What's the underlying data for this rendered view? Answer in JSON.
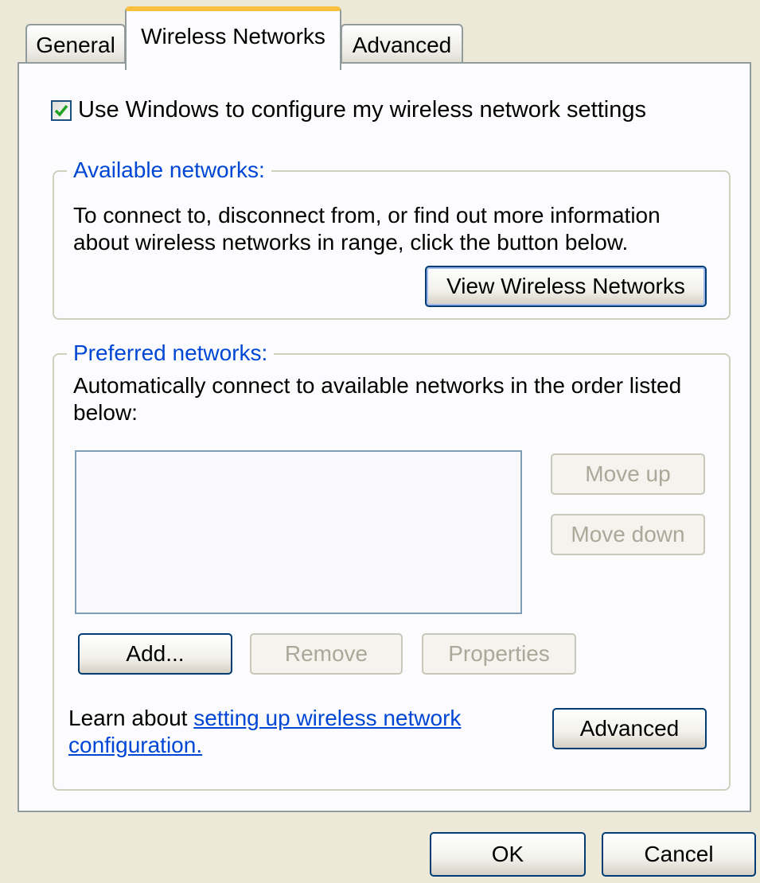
{
  "tabs": [
    {
      "label": "General",
      "active": false
    },
    {
      "label": "Wireless Networks",
      "active": true
    },
    {
      "label": "Advanced",
      "active": false
    }
  ],
  "use_windows_checkbox": {
    "label": "Use Windows to configure my wireless network settings",
    "checked": true
  },
  "available_networks": {
    "legend": "Available networks:",
    "description": "To connect to, disconnect from, or find out more information about wireless networks in range, click the button below.",
    "view_button": "View Wireless Networks"
  },
  "preferred_networks": {
    "legend": "Preferred networks:",
    "description": "Automatically connect to available networks in the order listed below:",
    "items": [],
    "move_up": "Move up",
    "move_down": "Move down",
    "add": "Add...",
    "remove": "Remove",
    "properties": "Properties",
    "learn_prefix": "Learn about ",
    "learn_link": "setting up wireless network configuration.",
    "advanced": "Advanced"
  },
  "footer": {
    "ok": "OK",
    "cancel": "Cancel"
  },
  "colors": {
    "accent": "#0046d5",
    "tab_highlight": "#f9c13d",
    "checkmark": "#21a121"
  }
}
